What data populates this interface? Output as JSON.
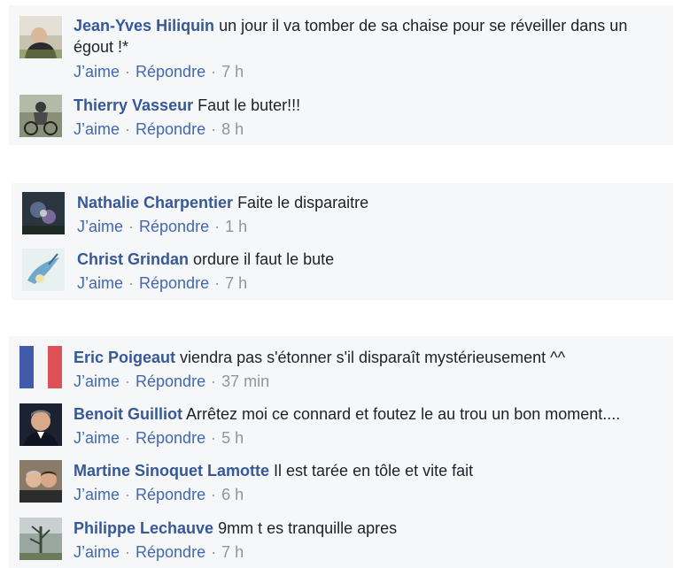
{
  "actions": {
    "like": "J’aime",
    "reply": "Répondre",
    "separator": "·"
  },
  "groups": [
    {
      "comments": [
        {
          "author": "Jean-Yves Hiliquin",
          "text": "un jour il va tomber de sa chaise pour se réveiller dans un égout !*",
          "time": "7 h",
          "avatar_icon": "person-avatar"
        },
        {
          "author": "Thierry Vasseur",
          "text": "Faut le buter!!!",
          "time": "8 h",
          "avatar_icon": "cyclist-avatar"
        }
      ]
    },
    {
      "comments": [
        {
          "author": "Nathalie Charpentier",
          "text": "Faite le disparaitre",
          "time": "1 h",
          "avatar_icon": "flower-avatar"
        },
        {
          "author": "Christ Grindan",
          "text": "ordure il faut le bute",
          "time": "7 h",
          "avatar_icon": "bird-avatar"
        }
      ]
    },
    {
      "comments": [
        {
          "author": "Eric Poigeaut",
          "text": "viendra pas s'étonner s'il disparaît mystérieusement ^^",
          "time": "37 min",
          "avatar_icon": "french-flag-avatar"
        },
        {
          "author": "Benoit Guilliot",
          "text": "Arrêtez moi ce connard et foutez le au trou un bon moment....",
          "time": "5 h",
          "avatar_icon": "portrait-avatar"
        },
        {
          "author": "Martine Sinoquet Lamotte",
          "text": "Il est tarée en tôle et vite fait",
          "time": "6 h",
          "avatar_icon": "couple-avatar"
        },
        {
          "author": "Philippe Lechauve",
          "text": "9mm t es tranquille apres",
          "time": "7 h",
          "avatar_icon": "landscape-avatar"
        }
      ]
    }
  ]
}
